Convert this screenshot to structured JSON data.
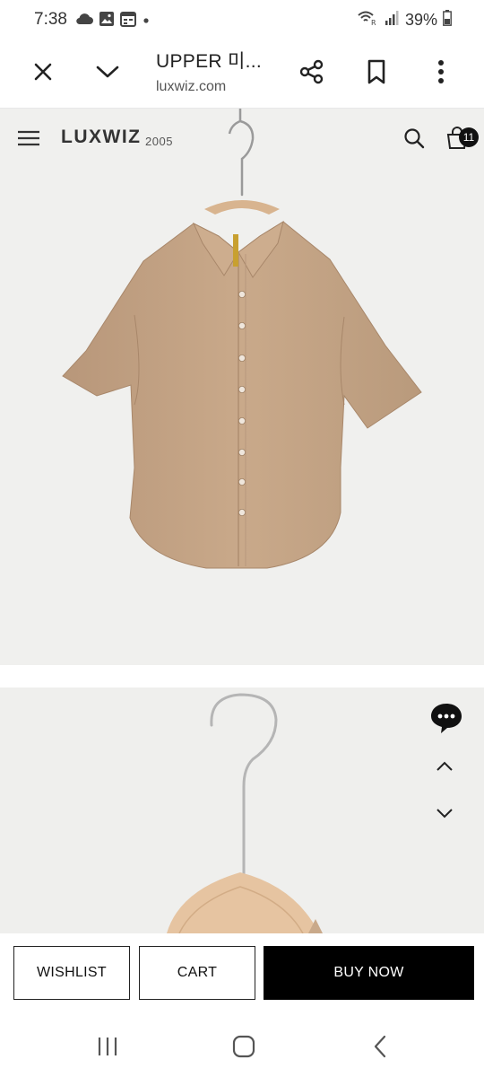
{
  "status": {
    "time": "7:38",
    "battery": "39%",
    "left_icons": [
      "cloud-icon",
      "image-icon",
      "calendar-icon",
      "dot-icon"
    ],
    "right_icons": [
      "alarm-wifi-icon",
      "signal-icon",
      "battery-icon"
    ]
  },
  "browser": {
    "title": "UPPER 미...",
    "url": "luxwiz.com",
    "icons": [
      "close-icon",
      "chevron-down-icon",
      "share-icon",
      "bookmark-icon",
      "more-icon"
    ]
  },
  "site": {
    "brand": "LUXWIZ",
    "year": "2005",
    "cart_count": "11",
    "icons": [
      "menu-icon",
      "search-icon",
      "cart-icon"
    ]
  },
  "product": {
    "shirt_color": "#c9a98a",
    "image_bg": "#f0f0ee"
  },
  "floating": {
    "icons": [
      "chat-icon",
      "chevron-up-icon",
      "chevron-down-icon"
    ]
  },
  "actions": {
    "wishlist": "WISHLIST",
    "cart": "CART",
    "buy_now": "BUY NOW"
  },
  "nav": {
    "icons": [
      "recents-icon",
      "home-icon",
      "back-icon"
    ]
  }
}
